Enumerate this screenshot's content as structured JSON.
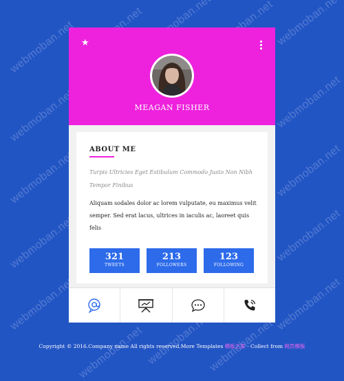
{
  "watermark": "webmoban.net",
  "profile": {
    "name": "MEAGAN FISHER"
  },
  "about": {
    "title": "ABOUT ME",
    "tagline": "Turpis Ultricies Eget Estibulum Commodo Justo Non Nibh Tempor Finibus",
    "bio": "Aliquam sodales dolor ac lorem vulputate, eu maximus velit semper. Sed erat lacus, ultrices in iaculis ac, laoreet quis felis"
  },
  "stats": [
    {
      "value": "321",
      "label": "TWEETS"
    },
    {
      "value": "213",
      "label": "FOLLOWERS"
    },
    {
      "value": "123",
      "label": "FOLLOWING"
    }
  ],
  "footer_icons": [
    "at-sign-icon",
    "presentation-icon",
    "chat-icon",
    "phone-icon"
  ],
  "copyright": {
    "text": "Copyright © 2016.Company name All rights reserved.More Templates ",
    "link1": "模板之家",
    "middle": " - Collect from ",
    "link2": "网页模板"
  },
  "colors": {
    "background": "#2255c4",
    "header": "#ee22dd",
    "stat_box": "#2d6bea",
    "accent": "#ee22dd"
  }
}
